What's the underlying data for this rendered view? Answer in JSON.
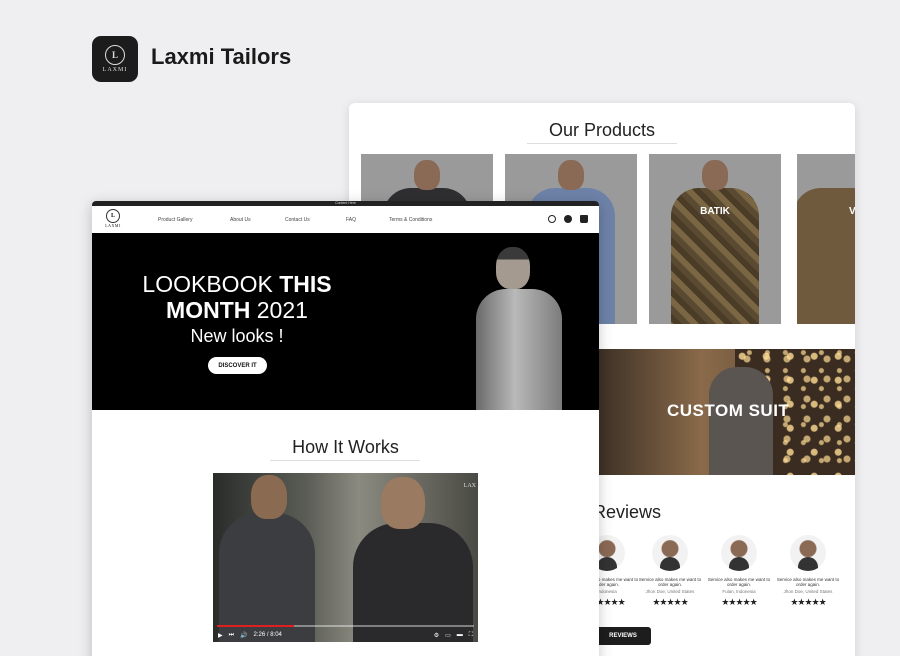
{
  "app": {
    "title": "Laxmi Tailors",
    "icon_text": "LAXMI",
    "icon": "laxmi-emblem-icon"
  },
  "products_page": {
    "title": "Our Products",
    "products": [
      {
        "label": ""
      },
      {
        "label": ""
      },
      {
        "label": "BATIK"
      },
      {
        "label": "V"
      }
    ],
    "custom_suit": "CUSTOM SUIT",
    "reviews_title": "r Reviews",
    "reviews": [
      {
        "quote": "Service also makes me want to order again.",
        "author": "Indonesia",
        "stars": "★★★★★"
      },
      {
        "quote": "Service also makes me want to order again.",
        "author": "Jhon Doe, United States",
        "stars": "★★★★★"
      },
      {
        "quote": "Service also makes me want to order again.",
        "author": "Fulan, Indonesia",
        "stars": "★★★★★"
      },
      {
        "quote": "Service also makes me want to order again.",
        "author": "Jhon Doe, United States",
        "stars": "★★★★★"
      }
    ],
    "reviews_button": "REVIEWS"
  },
  "home_page": {
    "topbar_text": "Content Here",
    "logo_text": "LAXMI",
    "nav": [
      "Product Gallery",
      "About Us",
      "Contact Us",
      "FAQ",
      "Terms & Conditions"
    ],
    "nav_icons": [
      "globe-icon",
      "user-icon",
      "bag-icon"
    ],
    "hero": {
      "line1_light": "LOOKBOOK ",
      "line1_bold": "THIS",
      "line2_bold": "MONTH",
      "line2_light": " 2021",
      "line3": "New looks !",
      "button": "DISCOVER IT"
    },
    "how_it_works_title": "How It Works",
    "video": {
      "watermark": "LAX",
      "time": "2:26 / 8:04",
      "progress_fraction": 0.3
    }
  },
  "colors": {
    "background": "#efeff1",
    "dark": "#1d1d1d",
    "progress": "#e02020"
  }
}
